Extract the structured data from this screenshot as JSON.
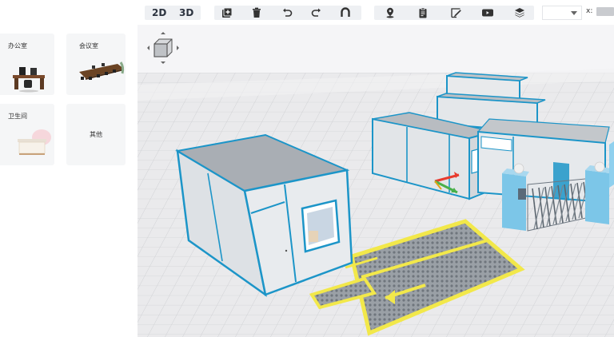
{
  "toolbar": {
    "view_2d": "2D",
    "view_3d": "3D",
    "coord_label": "x:",
    "dropdown_value": ""
  },
  "sidebar": {
    "cards": [
      {
        "label": "办公室"
      },
      {
        "label": "会议室"
      },
      {
        "label": "卫生间"
      },
      {
        "label": "其他"
      }
    ]
  },
  "colors": {
    "accent": "#2b9bd0",
    "frame": "#1c95c8",
    "marking": "#f2e84a",
    "grid_bg": "#e8e8ea"
  }
}
